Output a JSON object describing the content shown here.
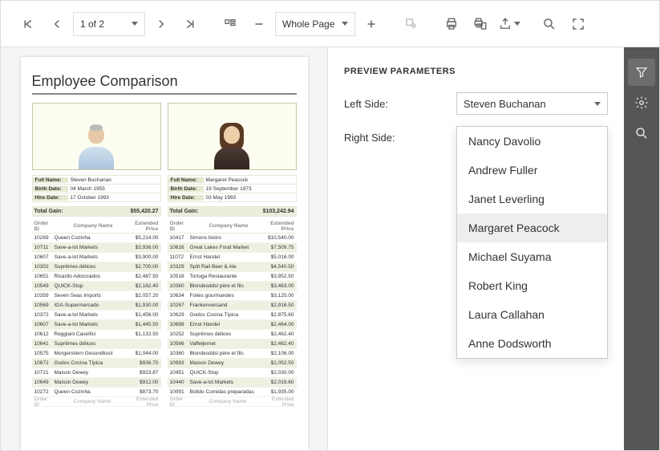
{
  "toolbar": {
    "page_of": "1 of 2",
    "zoom": "Whole Page"
  },
  "report": {
    "title": "Employee Comparison",
    "headers": {
      "order": "Order ID",
      "company": "Company Name",
      "price": "Extended Price",
      "total": "Total Gain:"
    },
    "field_labels": {
      "full_name": "Full Name:",
      "birth_date": "Birth Date:",
      "hire_date": "Hire Date:"
    },
    "left": {
      "name": "Steven Buchanan",
      "birth": "04 March 1955",
      "hire": "17 October 1993",
      "total": "$55,420.27",
      "rows": [
        {
          "id": "10269",
          "co": "Queen Cozinha",
          "p": "$5,214.00"
        },
        {
          "id": "10711",
          "co": "Save-a-lot Markets",
          "p": "$3,936.00"
        },
        {
          "id": "10607",
          "co": "Save-a-lot Markets",
          "p": "$3,900.00"
        },
        {
          "id": "10302",
          "co": "Suprêmes délices",
          "p": "$2,700.00"
        },
        {
          "id": "10651",
          "co": "Ricardo Adocicados",
          "p": "$2,487.50"
        },
        {
          "id": "10549",
          "co": "QUICK-Stop",
          "p": "$2,162.40"
        },
        {
          "id": "10359",
          "co": "Seven Seas Imports",
          "p": "$2,057.20"
        },
        {
          "id": "10569",
          "co": "IGA-Supermercado",
          "p": "$1,930.00"
        },
        {
          "id": "10372",
          "co": "Save-a-lot Markets",
          "p": "$1,456.00"
        },
        {
          "id": "10607",
          "co": "Save-a-lot Markets",
          "p": "$1,445.50"
        },
        {
          "id": "10612",
          "co": "Reggiani Caseifici",
          "p": "$1,132.50"
        },
        {
          "id": "10641",
          "co": "Suprêmes délices",
          "p": ""
        },
        {
          "id": "10575",
          "co": "Morgenstern Gesundkost",
          "p": "$1,044.00"
        },
        {
          "id": "10672",
          "co": "Godos Cocina Típica",
          "p": "$936.70"
        },
        {
          "id": "10721",
          "co": "Maison Dewey",
          "p": "$923.87"
        },
        {
          "id": "10649",
          "co": "Maison Dewey",
          "p": "$912.00"
        },
        {
          "id": "10272",
          "co": "Queen Cozinha",
          "p": "$873.70"
        }
      ]
    },
    "right": {
      "name": "Margaret Peacock",
      "birth": "19 September 1973",
      "hire": "03 May 1993",
      "total": "$103,242.94",
      "rows": [
        {
          "id": "10417",
          "co": "Simons bistro",
          "p": "$10,540.00"
        },
        {
          "id": "10616",
          "co": "Great Lakes Food Market",
          "p": "$7,509.75"
        },
        {
          "id": "11072",
          "co": "Ernst Handel",
          "p": "$5,016.00"
        },
        {
          "id": "10329",
          "co": "Split Rail Beer & Ale",
          "p": "$4,540.50"
        },
        {
          "id": "10518",
          "co": "Tortuga Restaurante",
          "p": "$3,952.50"
        },
        {
          "id": "10360",
          "co": "Blondesddsl père et fils",
          "p": "$3,463.00"
        },
        {
          "id": "10634",
          "co": "Folies gourmandes",
          "p": "$3,125.00"
        },
        {
          "id": "10267",
          "co": "Frankenversand",
          "p": "$2,916.50"
        },
        {
          "id": "10629",
          "co": "Godos Cocina Típica",
          "p": "$2,875.60"
        },
        {
          "id": "10698",
          "co": "Ernst Handel",
          "p": "$2,464.00"
        },
        {
          "id": "10252",
          "co": "Suprêmes délices",
          "p": "$2,462.40"
        },
        {
          "id": "10566",
          "co": "Vaffeljernet",
          "p": "$2,462.40"
        },
        {
          "id": "10360",
          "co": "Blondesddsl père et fils",
          "p": "$2,106.00"
        },
        {
          "id": "10993",
          "co": "Maison Dewey",
          "p": "$2,052.50"
        },
        {
          "id": "10451",
          "co": "QUICK-Stop",
          "p": "$2,030.00"
        },
        {
          "id": "10440",
          "co": "Save-a-lot Markets",
          "p": "$2,019.60"
        },
        {
          "id": "10091",
          "co": "Bólido Comidas preparadas",
          "p": "$1,935.00"
        }
      ]
    }
  },
  "panel": {
    "title": "PREVIEW PARAMETERS",
    "left_label": "Left Side:",
    "left_value": "Steven Buchanan",
    "right_label": "Right Side:",
    "right_value": "Margaret Peacock",
    "options": [
      "Nancy Davolio",
      "Andrew Fuller",
      "Janet Leverling",
      "Margaret Peacock",
      "Michael Suyama",
      "Robert King",
      "Laura Callahan",
      "Anne Dodsworth"
    ]
  }
}
